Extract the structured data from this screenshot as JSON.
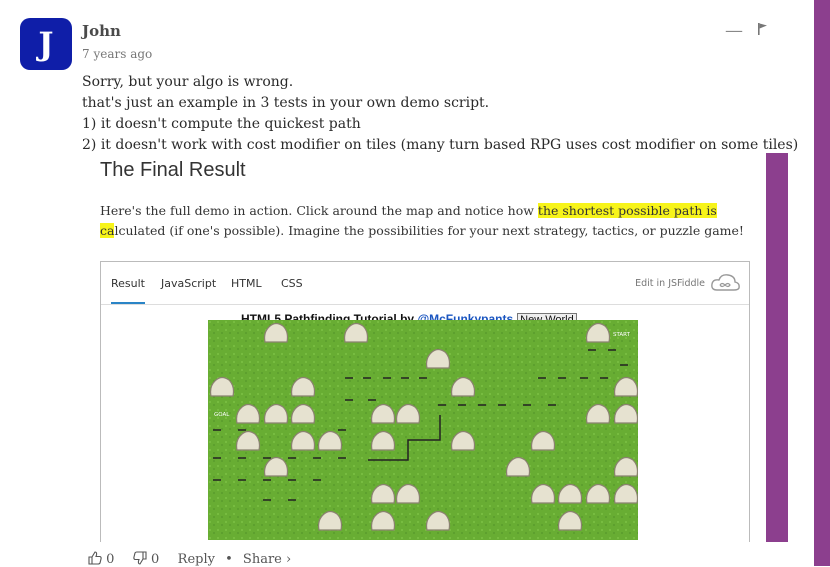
{
  "comment": {
    "avatar_letter": "J",
    "author": "John",
    "time": "7 years ago",
    "collapse_label": "—",
    "lines": [
      "Sorry, but your algo is wrong.",
      "that's just an example in 3 tests in your own demo script.",
      "1) it doesn't compute the quickest path",
      "2) it doesn't work with cost modifier on tiles (many turn based RPG uses cost modifier on some tiles)"
    ]
  },
  "screenshot": {
    "title": "The Final Result",
    "text_before": "Here's the full demo in action. Click around the map and notice how ",
    "text_highlight": "the shortest possible path is ca",
    "text_after": "lculated (if one's possible). Imagine the possibilities for your next strategy, tactics, or puzzle game!",
    "tabs": [
      "Result",
      "JavaScript",
      "HTML",
      "CSS"
    ],
    "edit_label": "Edit in JSFiddle",
    "game_title": "HTML5 Pathfinding Tutorial by ",
    "game_title_link": "@McFunkypants",
    "game_button": "New World",
    "start_label": "START",
    "goal_label": "GOAL"
  },
  "footer": {
    "upvotes": "0",
    "downvotes": "0",
    "reply": "Reply",
    "bullet": "•",
    "share": "Share ›"
  }
}
